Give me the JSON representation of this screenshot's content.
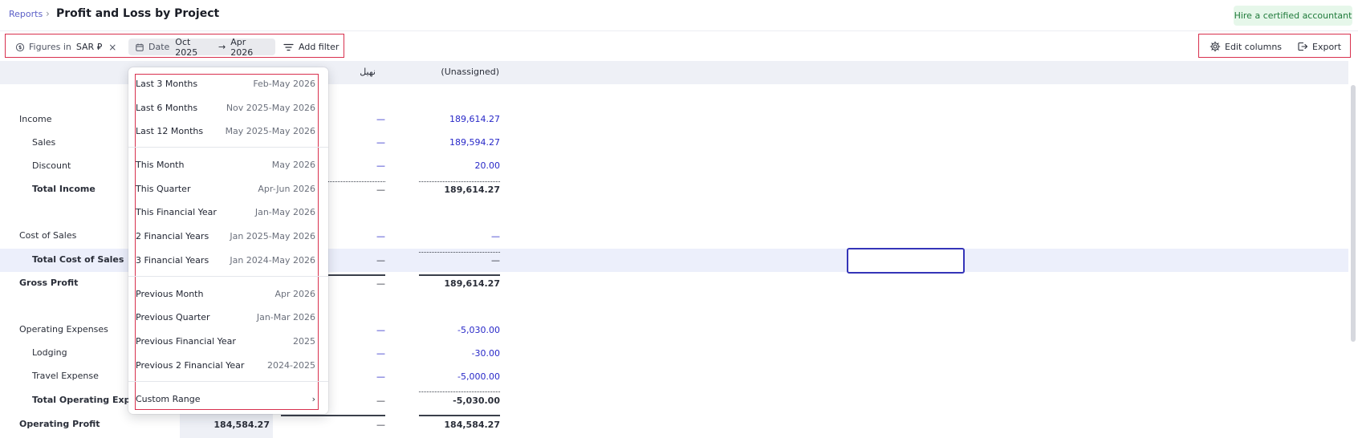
{
  "breadcrumb": {
    "parent": "Reports",
    "separator": "›"
  },
  "page_title": "Profit and Loss by Project",
  "hire_button": "Hire a certified accountant",
  "filters": {
    "figures_label": "Figures in",
    "figures_value": "SAR ⃁",
    "figures_close": "×",
    "date_label": "Date",
    "date_from": "Oct 2025",
    "date_arrow": "→",
    "date_to": "Apr 2026",
    "add_filter": "Add filter"
  },
  "toolbar": {
    "edit_columns": "Edit columns",
    "export": "Export"
  },
  "columns": {
    "col3": "نهيل",
    "col4": "(Unassigned)"
  },
  "rows": {
    "income": {
      "label": "Income",
      "c3": "—",
      "c4": "189,614.27"
    },
    "sales": {
      "label": "Sales",
      "c3": "—",
      "c4": "189,594.27"
    },
    "discount": {
      "label": "Discount",
      "c3": "—",
      "c4": "20.00"
    },
    "total_income": {
      "label": "Total Income",
      "c3": "—",
      "c4": "189,614.27"
    },
    "cost_of_sales": {
      "label": "Cost of Sales",
      "c3": "—",
      "c4": "—"
    },
    "total_cost_of_sales": {
      "label": "Total Cost of Sales",
      "c3": "—",
      "c4": "—"
    },
    "gross_profit": {
      "label": "Gross Profit",
      "c3": "—",
      "c4": "189,614.27"
    },
    "operating_expenses": {
      "label": "Operating Expenses",
      "c3": "—",
      "c4": "-5,030.00"
    },
    "lodging": {
      "label": "Lodging",
      "c3": "—",
      "c4": "-30.00"
    },
    "travel_expense": {
      "label": "Travel Expense",
      "c3": "—",
      "c4": "-5,000.00"
    },
    "total_operating_expenses": {
      "label": "Total Operating Expens",
      "c3": "—",
      "c4": "-5,030.00"
    },
    "operating_profit": {
      "label": "Operating Profit",
      "c2": "184,584.27",
      "c3": "—",
      "c4": "184,584.27"
    }
  },
  "date_menu": {
    "items": [
      {
        "label": "Last 3 Months",
        "range": "Feb-May 2026"
      },
      {
        "label": "Last 6 Months",
        "range": "Nov 2025-May 2026"
      },
      {
        "label": "Last 12 Months",
        "range": "May 2025-May 2026"
      },
      {
        "label": "This Month",
        "range": "May 2026"
      },
      {
        "label": "This Quarter",
        "range": "Apr-Jun 2026"
      },
      {
        "label": "This Financial Year",
        "range": "Jan-May 2026"
      },
      {
        "label": "2 Financial Years",
        "range": "Jan 2025-May 2026"
      },
      {
        "label": "3 Financial Years",
        "range": "Jan 2024-May 2026"
      },
      {
        "label": "Previous Month",
        "range": "Apr 2026"
      },
      {
        "label": "Previous Quarter",
        "range": "Jan-Mar 2026"
      },
      {
        "label": "Previous Financial Year",
        "range": "2025"
      },
      {
        "label": "Previous 2 Financial Year",
        "range": "2024-2025"
      },
      {
        "label": "Custom Range",
        "range": "›"
      }
    ]
  },
  "colors": {
    "accent": "#5b5fc7",
    "highlight": "#d8304e",
    "value_blue": "#2828c8",
    "success_bg": "#e6f7ea"
  }
}
